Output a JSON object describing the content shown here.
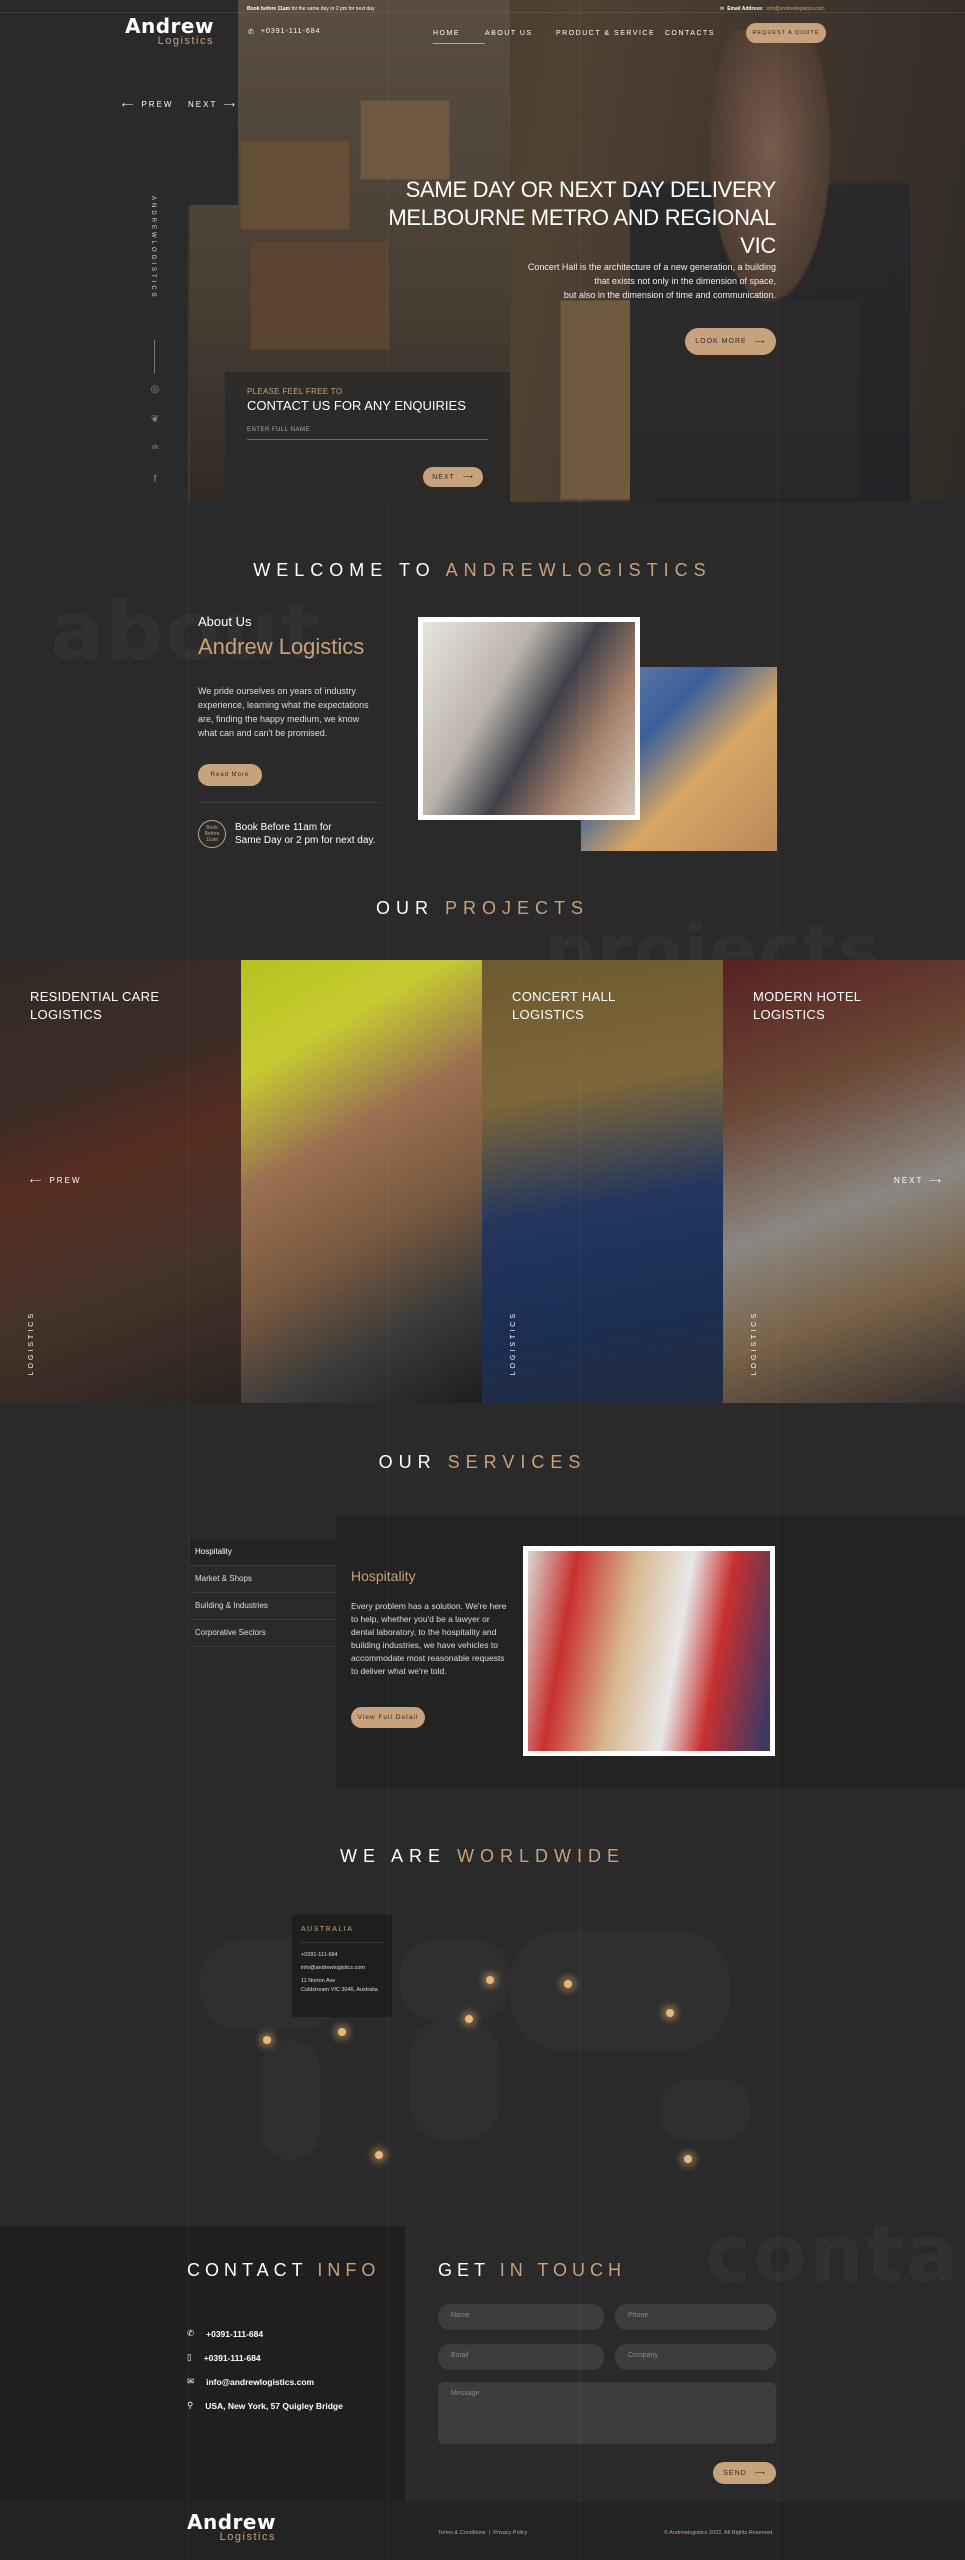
{
  "brand": {
    "name": "Andrew",
    "sub": "Logistics",
    "accent": "#c8a27c"
  },
  "topbar": {
    "notice_label": "Book before 11am",
    "notice_text": "for the same day or 2 pm for next day",
    "phone": "+0391-111-684",
    "email_label": "Email Address:",
    "email": "info@andrewlogistics.com"
  },
  "nav": {
    "items": [
      "Home",
      "About Us",
      "Product & Service",
      "Contacts"
    ],
    "cta": "Request a quote"
  },
  "hero": {
    "prev": "PREW",
    "next": "NEXT",
    "title_line1": "SAME DAY OR NEXT DAY DELIVERY",
    "title_line2": "MELBOURNE METRO AND REGIONAL VIC",
    "desc_line1": "Concert Hall is the architecture of a new generation, a building",
    "desc_line2": "that exists not only in the dimension of space,",
    "desc_line3": "but also in the dimension of time and communication.",
    "button": "LOOK MORE",
    "vertical_text": "ANDREWLOGISTICS"
  },
  "enquiry": {
    "pre": "PLEASE FEEL FREE TO",
    "title": "CONTACT US FOR ANY ENQUIRIES",
    "placeholder": "ENTER FULL NAME",
    "button": "NEXT"
  },
  "social": {
    "icons": [
      "instagram-icon",
      "twitter-icon",
      "vk-icon",
      "facebook-icon"
    ]
  },
  "welcome": {
    "prefix": "WELCOME TO",
    "highlight": "ANDREWLOGISTICS",
    "ghost": "about"
  },
  "about": {
    "kicker": "About Us",
    "title": "Andrew Logistics",
    "text": "We pride ourselves on years of industry experience, learning what the expectations are, finding the happy medium, we know what can and can't be promised.",
    "button": "Read More",
    "badge_text": "Book Before 11am",
    "book_line1": "Book Before 11am for",
    "book_line2": "Same Day or 2 pm for next day."
  },
  "projects": {
    "prefix": "OUR",
    "highlight": "PROJECTS",
    "ghost": "projects",
    "prev": "PREW",
    "next": "NEXT",
    "items": [
      {
        "title_l1": "RESIDENTIAL CARE",
        "title_l2": "LOGISTICS",
        "vlabel": "LOGISTICS"
      },
      {
        "title_l1": "",
        "title_l2": "",
        "vlabel": ""
      },
      {
        "title_l1": "CONCERT HALL",
        "title_l2": "LOGISTICS",
        "vlabel": "LOGISTICS"
      },
      {
        "title_l1": "MODERN HOTEL",
        "title_l2": "LOGISTICS",
        "vlabel": "LOGISTICS"
      }
    ]
  },
  "services": {
    "prefix": "OUR",
    "highlight": "SERVICES",
    "tabs": [
      "Hospitality",
      "Market & Shops",
      "Building & Industries",
      "Corporative Sectors"
    ],
    "active_title": "Hospitality",
    "active_text": "Every problem has a solution. We're here to help, whether you'd be a lawyer or dental laboratory, to the hospitality and building industries, we have vehicles to accommodate most reasonable requests to deliver what we're told.",
    "button": "View Full Detail"
  },
  "worldwide": {
    "prefix": "WE ARE",
    "highlight": "WORLDWIDE",
    "card": {
      "title": "AUSTRALIA",
      "phone": "+0391-111-684",
      "email": "info@andrewlogistics.com",
      "addr1": "11 Norton Ave",
      "addr2": "Coldstream VIC 3046, Australia"
    }
  },
  "contact_info": {
    "prefix": "CONTACT",
    "highlight": "INFO",
    "phone1": "+0391-111-684",
    "phone2": "+0391-111-684",
    "email": "info@andrewlogistics.com",
    "address": "USA, New York, 57 Quigley Bridge"
  },
  "get_in_touch": {
    "prefix": "GET",
    "highlight": "IN TOUCH",
    "ghost": "conta",
    "name_ph": "Name",
    "phone_ph": "Phone",
    "email_ph": "Email",
    "company_ph": "Company",
    "message_ph": "Message",
    "button": "SEND"
  },
  "footer": {
    "links": "Terms & Conditions  |  Privacy Policy",
    "copy_brand": "© Andrewlogistics",
    "copy_rest": "2022. All Rights Reserved."
  }
}
